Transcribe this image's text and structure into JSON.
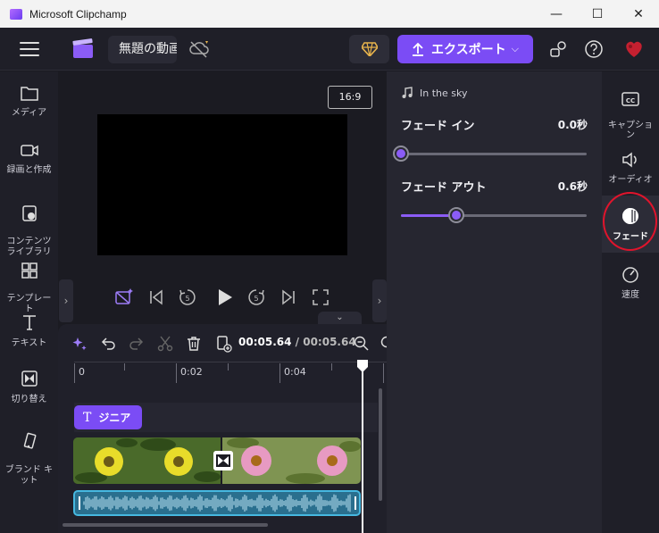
{
  "window": {
    "title": "Microsoft Clipchamp",
    "controls": {
      "minimize": "—",
      "maximize": "☐",
      "close": "✕"
    }
  },
  "topbar": {
    "project_title": "無題の動画",
    "export_label": "エクスポート",
    "export_chevron": "⌵"
  },
  "left_nav": [
    {
      "label": "メディア",
      "icon": "folder-icon"
    },
    {
      "label": "録画と作成",
      "icon": "camera-icon"
    },
    {
      "label": "コンテンツ\nライブラリ",
      "icon": "content-library-icon"
    },
    {
      "label": "テンプレー\nト",
      "icon": "templates-icon"
    },
    {
      "label": "テキスト",
      "icon": "text-icon"
    },
    {
      "label": "切り替え",
      "icon": "transitions-icon"
    },
    {
      "label": "ブランド キ\nット",
      "icon": "brand-kit-icon"
    }
  ],
  "preview": {
    "aspect_ratio": "16:9",
    "collapse_chevron": "⌄",
    "left_arrow": "›",
    "right_arrow": "›"
  },
  "timeline": {
    "current_time": "00:05.64",
    "separator": " / ",
    "total_time": "00:05.64",
    "ticks": [
      "0",
      "0:02",
      "0:04"
    ],
    "text_clip_label": "ジニア",
    "text_clip_icon": "T"
  },
  "fade_panel": {
    "track_name": "In the sky",
    "fade_in": {
      "label": "フェード イン",
      "value": "0.0秒",
      "fraction": 0.0
    },
    "fade_out": {
      "label": "フェード アウト",
      "value": "0.6秒",
      "fraction": 0.3
    }
  },
  "right_nav": [
    {
      "label": "キャプショ\nン",
      "icon": "captions-icon",
      "active": false
    },
    {
      "label": "オーディオ",
      "icon": "audio-icon",
      "active": false
    },
    {
      "label": "フェード",
      "icon": "fade-icon",
      "active": true
    },
    {
      "label": "速度",
      "icon": "speed-icon",
      "active": false
    }
  ],
  "colors": {
    "accent": "#7b4cf5",
    "slider": "#8b5cf6",
    "highlight_circle": "#e0142c",
    "audio_clip": "#2a6f8e"
  }
}
